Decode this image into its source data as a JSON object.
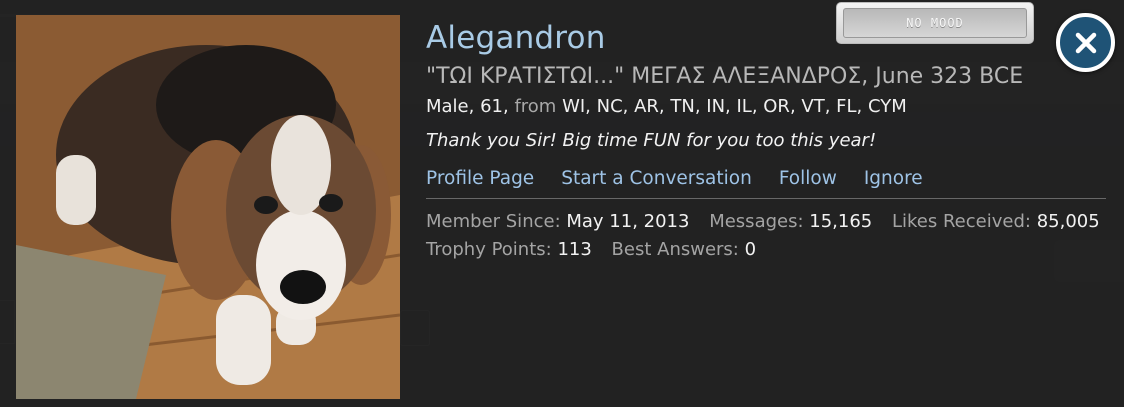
{
  "profile": {
    "name": "Alegandron",
    "custom_title": "\"ΤΩΙ ΚΡΑΤΙΣΤΩΙ...\" ΜΕΓΑΣ ΑΛΕΞΑΝΔΡΟΣ, June 323 BCE",
    "info": {
      "gender_age": "Male, 61,",
      "from_label": "from",
      "location": "WI, NC, AR, TN, IN, IL, OR, VT, FL, CYM"
    },
    "status_message": "Thank you Sir! Big time FUN for you too this year!",
    "links": {
      "profile_page": "Profile Page",
      "start_conversation": "Start a Conversation",
      "follow": "Follow",
      "ignore": "Ignore"
    },
    "stats": {
      "member_since_label": "Member Since:",
      "member_since": "May 11, 2013",
      "messages_label": "Messages:",
      "messages": "15,165",
      "likes_label": "Likes Received:",
      "likes": "85,005",
      "trophy_label": "Trophy Points:",
      "trophy": "113",
      "best_answers_label": "Best Answers:",
      "best_answers": "0"
    }
  },
  "mood_button": {
    "label": "NO MOOD"
  },
  "close_button": {
    "icon": "close-icon"
  },
  "avatar": {
    "icon": "dog-photo"
  },
  "colors": {
    "name_link": "#a9cbe6",
    "action_link": "#9ec3e6",
    "close_bg": "#1f5376"
  }
}
